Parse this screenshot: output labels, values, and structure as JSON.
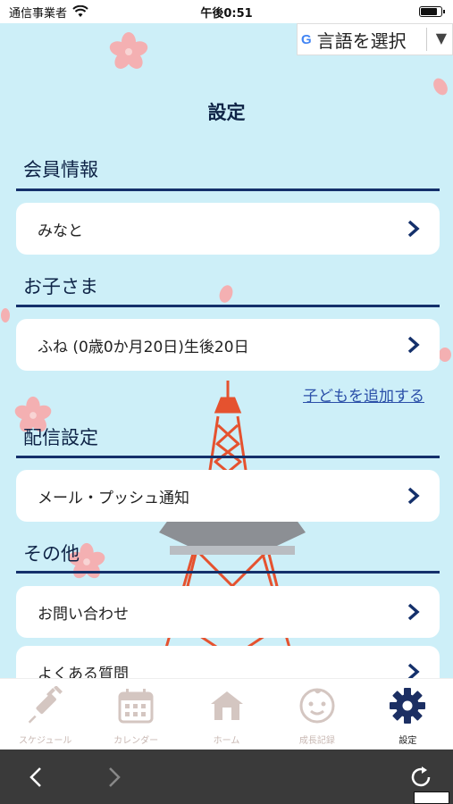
{
  "status_bar": {
    "carrier": "通信事業者",
    "time": "午後0:51"
  },
  "translate": {
    "logo": "G",
    "label": "言語を選択",
    "arrow": "▼"
  },
  "page_title": "設定",
  "sections": {
    "member": {
      "heading": "会員情報",
      "rows": [
        {
          "label": "みなと"
        }
      ]
    },
    "children": {
      "heading": "お子さま",
      "rows": [
        {
          "label": "ふね (0歳0か月20日)生後20日"
        }
      ],
      "add_link": "子どもを追加する"
    },
    "delivery": {
      "heading": "配信設定",
      "rows": [
        {
          "label": "メール・プッシュ通知"
        }
      ]
    },
    "other": {
      "heading": "その他",
      "rows": [
        {
          "label": "お問い合わせ"
        },
        {
          "label": "よくある質問"
        }
      ]
    }
  },
  "tab_bar": {
    "tabs": [
      {
        "label": "スケジュール",
        "icon": "syringe-icon",
        "active": false
      },
      {
        "label": "カレンダー",
        "icon": "calendar-icon",
        "active": false
      },
      {
        "label": "ホーム",
        "icon": "house-icon",
        "active": false
      },
      {
        "label": "成長記録",
        "icon": "baby-face-icon",
        "active": false
      },
      {
        "label": "設定",
        "icon": "gear-icon",
        "active": true
      }
    ]
  },
  "colors": {
    "background": "#cdeff8",
    "navy": "#14306b",
    "tab_inactive": "#c8b8b3",
    "tab_active": "#1c2f63",
    "tower_red": "#e5522f"
  }
}
